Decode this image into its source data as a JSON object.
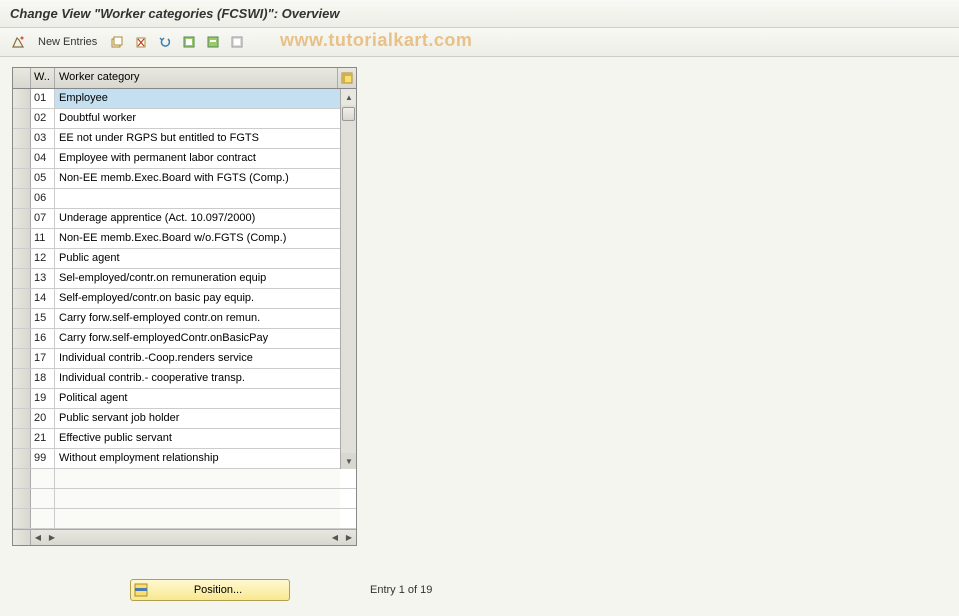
{
  "title": "Change View \"Worker categories (FCSWI)\": Overview",
  "toolbar": {
    "new_entries": "New Entries"
  },
  "watermark": "www.tutorialkart.com",
  "table": {
    "col_code": "W..",
    "col_category": "Worker category",
    "rows": [
      {
        "code": "01",
        "cat": "Employee",
        "selected": true
      },
      {
        "code": "02",
        "cat": "Doubtful worker"
      },
      {
        "code": "03",
        "cat": "EE not under RGPS but entitled to FGTS"
      },
      {
        "code": "04",
        "cat": "Employee with permanent labor contract"
      },
      {
        "code": "05",
        "cat": "Non-EE memb.Exec.Board with FGTS (Comp.)"
      },
      {
        "code": "06",
        "cat": ""
      },
      {
        "code": "07",
        "cat": "Underage apprentice (Act. 10.097/2000)"
      },
      {
        "code": "11",
        "cat": "Non-EE memb.Exec.Board w/o.FGTS (Comp.)"
      },
      {
        "code": "12",
        "cat": "Public agent"
      },
      {
        "code": "13",
        "cat": "Sel-employed/contr.on remuneration equip"
      },
      {
        "code": "14",
        "cat": "Self-employed/contr.on basic pay equip."
      },
      {
        "code": "15",
        "cat": "Carry forw.self-employed contr.on remun."
      },
      {
        "code": "16",
        "cat": "Carry forw.self-employedContr.onBasicPay"
      },
      {
        "code": "17",
        "cat": "Individual contrib.-Coop.renders service"
      },
      {
        "code": "18",
        "cat": "Individual contrib.- cooperative transp."
      },
      {
        "code": "19",
        "cat": "Political agent"
      },
      {
        "code": "20",
        "cat": "Public servant job holder"
      },
      {
        "code": "21",
        "cat": "Effective public servant"
      },
      {
        "code": "99",
        "cat": "Without employment relationship"
      }
    ]
  },
  "position_button": "Position...",
  "status": "Entry 1 of 19"
}
